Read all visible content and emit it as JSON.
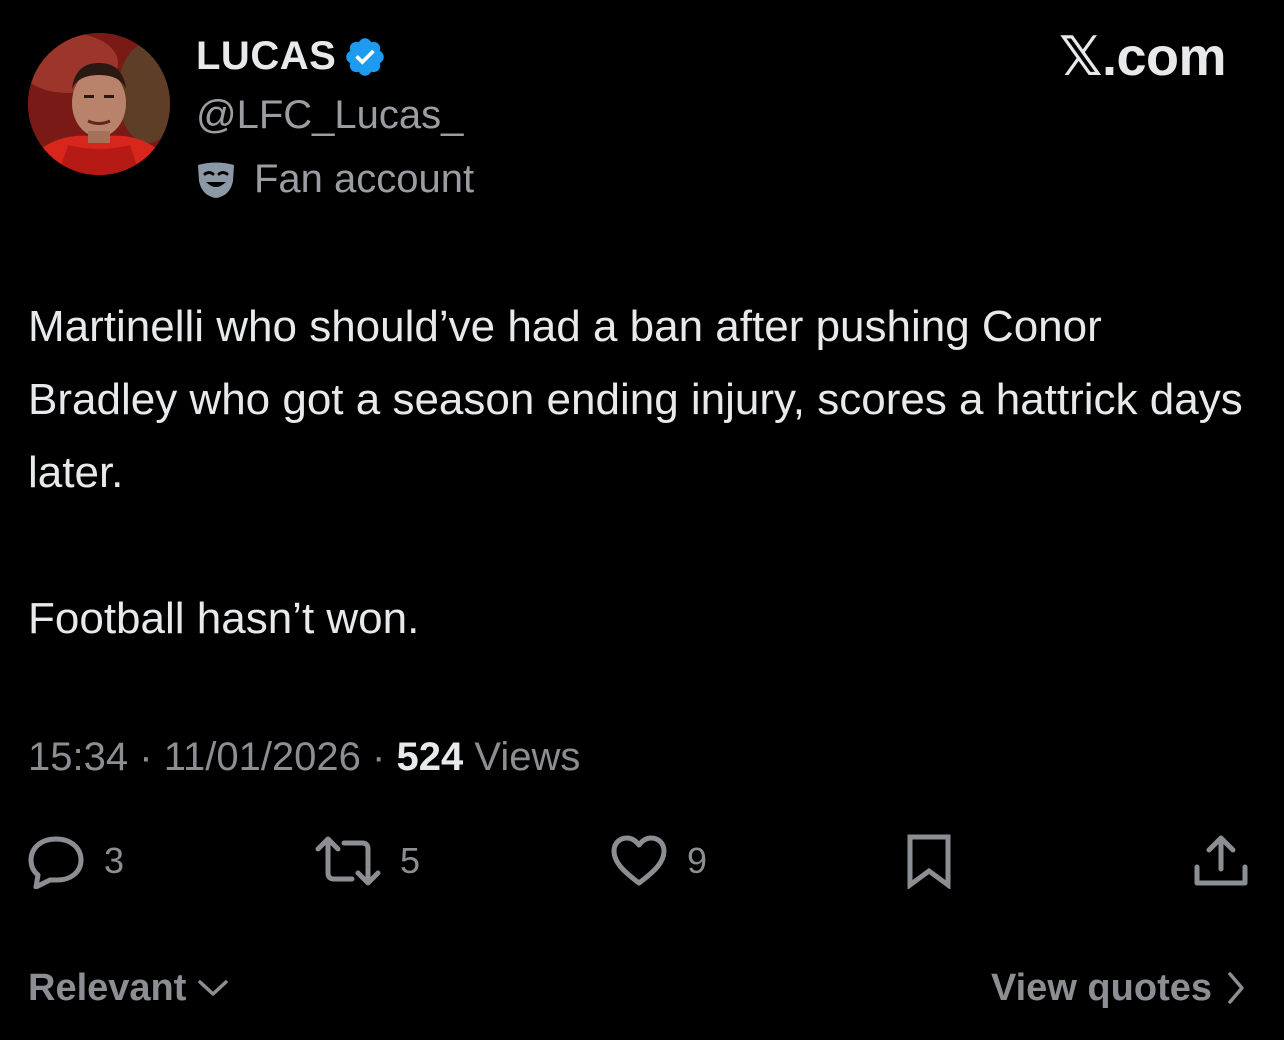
{
  "author": {
    "display_name": "LUCAS",
    "handle": "@LFC_Lucas_",
    "label": "Fan account",
    "avatar_icon": "profile-photo",
    "verified_icon": "verified-badge-icon",
    "verified_color": "#1d9bf0"
  },
  "brand": "𝕏.com",
  "tweet": {
    "paragraphs": [
      "Martinelli who should’ve had a ban after pushing Conor Bradley who got a season ending injury, scores a hattrick days later.",
      "Football hasn’t won."
    ]
  },
  "meta": {
    "time": "15:34",
    "separator": "·",
    "date": "11/01/2026",
    "views_count": "524",
    "views_label": "Views"
  },
  "actions": {
    "replies": "3",
    "reposts": "5",
    "likes": "9"
  },
  "footer": {
    "sort_label": "Relevant",
    "view_quotes_label": "View quotes"
  },
  "colors": {
    "background": "#000000",
    "text_primary": "#e7e9ea",
    "text_secondary": "#8b8e92"
  }
}
